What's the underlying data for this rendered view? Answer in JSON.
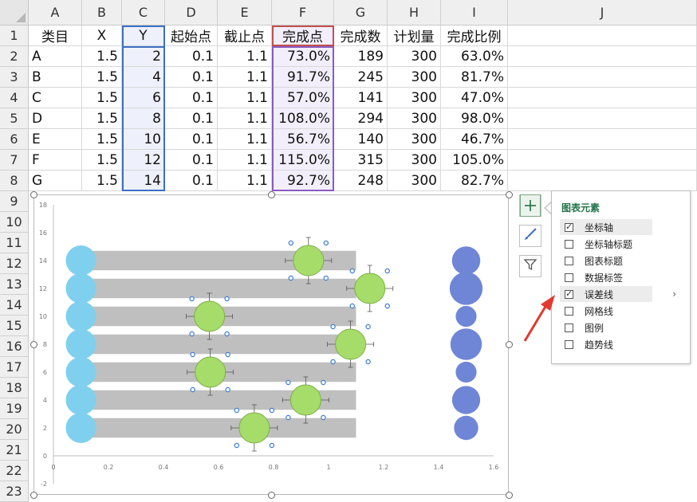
{
  "columns": [
    "A",
    "B",
    "C",
    "D",
    "E",
    "F",
    "G",
    "H",
    "I",
    "J"
  ],
  "rows": [
    "1",
    "2",
    "3",
    "4",
    "5",
    "6",
    "7",
    "8",
    "9",
    "10",
    "11",
    "12",
    "13",
    "14",
    "15",
    "16",
    "17",
    "18",
    "19",
    "20",
    "21",
    "22",
    "23"
  ],
  "table": {
    "headers": [
      "类目",
      "X",
      "Y",
      "起始点",
      "截止点",
      "完成点",
      "完成数",
      "计划量",
      "完成比例"
    ],
    "data": [
      [
        "A",
        "1.5",
        "2",
        "0.1",
        "1.1",
        "73.0%",
        "189",
        "300",
        "63.0%"
      ],
      [
        "B",
        "1.5",
        "4",
        "0.1",
        "1.1",
        "91.7%",
        "245",
        "300",
        "81.7%"
      ],
      [
        "C",
        "1.5",
        "6",
        "0.1",
        "1.1",
        "57.0%",
        "141",
        "300",
        "47.0%"
      ],
      [
        "D",
        "1.5",
        "8",
        "0.1",
        "1.1",
        "108.0%",
        "294",
        "300",
        "98.0%"
      ],
      [
        "E",
        "1.5",
        "10",
        "0.1",
        "1.1",
        "56.7%",
        "140",
        "300",
        "46.7%"
      ],
      [
        "F",
        "1.5",
        "12",
        "0.1",
        "1.1",
        "115.0%",
        "315",
        "300",
        "105.0%"
      ],
      [
        "G",
        "1.5",
        "14",
        "0.1",
        "1.1",
        "92.7%",
        "248",
        "300",
        "82.7%"
      ]
    ]
  },
  "chart_data": {
    "type": "scatter",
    "title": "",
    "xlabel": "",
    "ylabel": "",
    "xlim": [
      0,
      1.6
    ],
    "ylim": [
      -2,
      18
    ],
    "x_ticks": [
      "0",
      "0.2",
      "0.4",
      "0.6",
      "0.8",
      "1",
      "1.2",
      "1.4",
      "1.6"
    ],
    "y_ticks": [
      "-2",
      "0",
      "2",
      "4",
      "6",
      "8",
      "10",
      "12",
      "14",
      "16",
      "18"
    ],
    "categories": [
      "A",
      "B",
      "C",
      "D",
      "E",
      "F",
      "G"
    ],
    "bars": {
      "start": [
        0.1,
        0.1,
        0.1,
        0.1,
        0.1,
        0.1,
        0.1
      ],
      "end": [
        1.1,
        1.1,
        1.1,
        1.1,
        1.1,
        1.1,
        1.1
      ],
      "y": [
        2,
        4,
        6,
        8,
        10,
        12,
        14
      ],
      "color": "#bfbfbf"
    },
    "start_points": {
      "x": [
        0.1,
        0.1,
        0.1,
        0.1,
        0.1,
        0.1,
        0.1
      ],
      "y": [
        2,
        4,
        6,
        8,
        10,
        12,
        14
      ],
      "color": "#7fd0ee"
    },
    "completion_points": {
      "x": [
        0.73,
        0.917,
        0.57,
        1.08,
        0.567,
        1.15,
        0.927
      ],
      "y": [
        2,
        4,
        6,
        8,
        10,
        12,
        14
      ],
      "color": "#a6dc6a"
    },
    "ratio_points": {
      "x": [
        1.5,
        1.5,
        1.5,
        1.5,
        1.5,
        1.5,
        1.5
      ],
      "y": [
        2,
        4,
        6,
        8,
        10,
        12,
        14
      ],
      "values": [
        0.63,
        0.817,
        0.47,
        0.98,
        0.467,
        1.05,
        0.827
      ],
      "color": "#6f86d6"
    }
  },
  "chart_panel": {
    "title": "图表元素",
    "items": [
      {
        "label": "坐标轴",
        "checked": true
      },
      {
        "label": "坐标轴标题",
        "checked": false
      },
      {
        "label": "图表标题",
        "checked": false
      },
      {
        "label": "数据标签",
        "checked": false
      },
      {
        "label": "误差线",
        "checked": true
      },
      {
        "label": "网格线",
        "checked": false
      },
      {
        "label": "图例",
        "checked": false
      },
      {
        "label": "趋势线",
        "checked": false
      }
    ],
    "submenu_arrow": "›"
  },
  "side_buttons": [
    "plus-icon",
    "brush-icon",
    "filter-icon"
  ],
  "colors": {
    "selection_blue": "#3c6fc4",
    "selection_purple": "#8a5bc0",
    "header_highlight_red": "#c0504d",
    "accent_green": "#217346",
    "pointer_red": "#e23a2e"
  }
}
